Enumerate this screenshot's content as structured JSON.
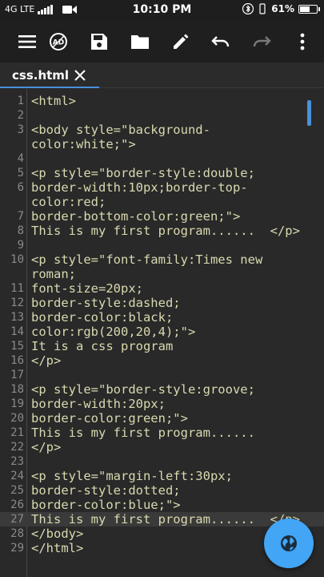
{
  "status": {
    "network": "4G LTE",
    "time": "10:10 PM",
    "battery": "61%",
    "battery_level": 0.61
  },
  "toolbar": {
    "icons": [
      "menu-icon",
      "ad-icon",
      "save-icon",
      "folder-icon",
      "edit-icon",
      "undo-icon",
      "redo-icon",
      "more-vert-icon"
    ]
  },
  "tab": {
    "label": "css.html"
  },
  "editor": {
    "current_line": 27,
    "lines": [
      {
        "n": "1",
        "text": "<html>"
      },
      {
        "n": "2",
        "text": ""
      },
      {
        "n": "3",
        "text": "<body style=\"background-"
      },
      {
        "n": "",
        "text": "color:white;\">"
      },
      {
        "n": "4",
        "text": ""
      },
      {
        "n": "5",
        "text": "<p style=\"border-style:double;"
      },
      {
        "n": "6",
        "text": "border-width:10px;border-top-"
      },
      {
        "n": "",
        "text": "color:red;"
      },
      {
        "n": "7",
        "text": "border-bottom-color:green;\">"
      },
      {
        "n": "8",
        "text": "This is my first program......  </p>"
      },
      {
        "n": "9",
        "text": ""
      },
      {
        "n": "10",
        "text": "<p style=\"font-family:Times new"
      },
      {
        "n": "",
        "text": "roman;"
      },
      {
        "n": "11",
        "text": "font-size=20px;"
      },
      {
        "n": "12",
        "text": "border-style:dashed;"
      },
      {
        "n": "13",
        "text": "border-color:black;"
      },
      {
        "n": "14",
        "text": "color:rgb(200,20,4);\">"
      },
      {
        "n": "15",
        "text": "It is a css program"
      },
      {
        "n": "16",
        "text": "</p>"
      },
      {
        "n": "17",
        "text": ""
      },
      {
        "n": "18",
        "text": "<p style=\"border-style:groove;"
      },
      {
        "n": "19",
        "text": "border-width:20px;"
      },
      {
        "n": "20",
        "text": "border-color:green;\">"
      },
      {
        "n": "21",
        "text": "This is my first program......"
      },
      {
        "n": "22",
        "text": "</p>"
      },
      {
        "n": "23",
        "text": ""
      },
      {
        "n": "24",
        "text": "<p style=\"margin-left:30px;"
      },
      {
        "n": "25",
        "text": "border-style:dotted;"
      },
      {
        "n": "26",
        "text": "border-color:blue;\">"
      },
      {
        "n": "27",
        "text": "This is my first program......  </p>"
      },
      {
        "n": "28",
        "text": "</body>"
      },
      {
        "n": "29",
        "text": "</html>"
      }
    ]
  },
  "fab": {
    "icon": "globe-icon"
  }
}
